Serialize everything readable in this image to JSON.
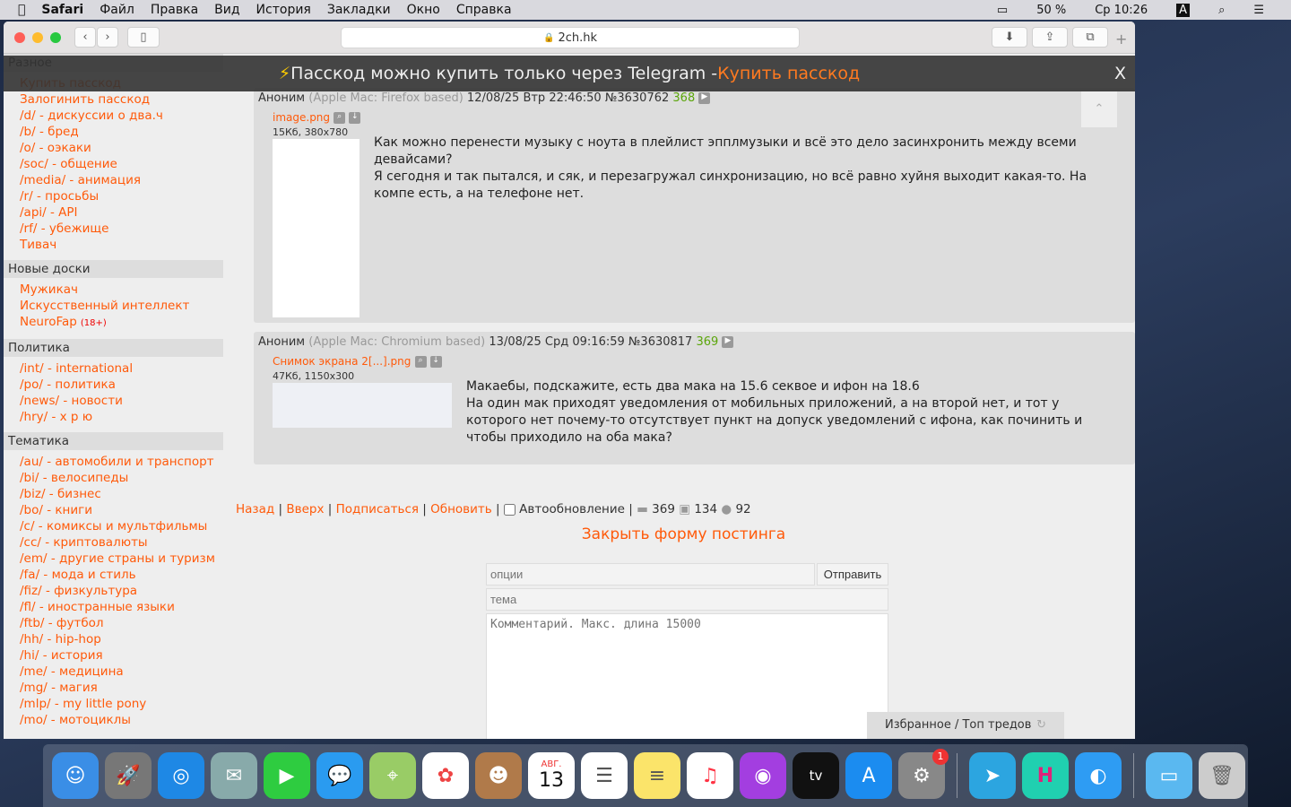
{
  "menubar": {
    "app": "Safari",
    "items": [
      "Файл",
      "Правка",
      "Вид",
      "История",
      "Закладки",
      "Окно",
      "Справка"
    ],
    "battery": "50 %",
    "clock": "Ср 10:26",
    "input": "A"
  },
  "browser": {
    "url": "2ch.hk"
  },
  "banner": {
    "text": "Пасскод можно купить только через Telegram - ",
    "link": "Купить пасскод",
    "close": "X"
  },
  "sidebar": {
    "groups": [
      {
        "title": "Разное",
        "items": [
          "Купить пасскод",
          "Залогинить пасскод",
          "/d/ - дискуссии о два.ч",
          "/b/ - бред",
          "/o/ - оэкаки",
          "/soc/ - общение",
          "/media/ - анимация",
          "/r/ - просьбы",
          "/api/ - API",
          "/rf/ - убежище",
          "Тивач"
        ]
      },
      {
        "title": "Новые доски",
        "items": [
          "Мужикач",
          "Искусственный интеллект",
          "NeuroFap"
        ],
        "badge": "(18+)"
      },
      {
        "title": "Политика",
        "items": [
          "/int/ - international",
          "/po/ - политика",
          "/news/ - новости",
          "/hry/ - х р ю"
        ]
      },
      {
        "title": "Тематика",
        "items": [
          "/au/ - автомобили и транспорт",
          "/bi/ - велосипеды",
          "/biz/ - бизнес",
          "/bo/ - книги",
          "/c/ - комиксы и мультфильмы",
          "/cc/ - криптовалюты",
          "/em/ - другие страны и туризм",
          "/fa/ - мода и стиль",
          "/fiz/ - физкультура",
          "/fl/ - иностранные языки",
          "/ftb/ - футбол",
          "/hh/ - hip-hop",
          "/hi/ - история",
          "/me/ - медицина",
          "/mg/ - магия",
          "/mlp/ - my little pony",
          "/mo/ - мотоциклы"
        ]
      }
    ]
  },
  "posts": [
    {
      "name": "Аноним",
      "ua": "(Apple Mac: Firefox based)",
      "date": "12/08/25 Втр 22:46:50",
      "num": "№3630762",
      "idx": "368",
      "file": "image.png",
      "meta": "15Кб, 380x780",
      "text": "Как можно перенести музыку с ноута в плейлист эпплмузыки и всё это дело засинхронить между всеми девайсами?\nЯ сегодня и так пытался, и сяк, и перезагружал синхронизацию, но всё равно хуйня выходит какая-то. На компе есть, а на телефоне нет."
    },
    {
      "name": "Аноним",
      "ua": "(Apple Mac: Chromium based)",
      "date": "13/08/25 Срд 09:16:59",
      "num": "№3630817",
      "idx": "369",
      "file": "Снимок экрана 2[...].png",
      "meta": "47Кб, 1150x300",
      "text": "Макаебы, подскажите, есть два мака на 15.6 секвое и ифон на 18.6\nНа один мак приходят уведомления от мобильных приложений, а на второй нет, и тот у которого нет почему-то отсутствует пункт на допуск уведомлений с ифона, как починить и чтобы приходило на оба мака?"
    }
  ],
  "footer": {
    "back": "Назад",
    "top": "Вверх",
    "subscribe": "Подписаться",
    "refresh": "Обновить",
    "autoupdate": "Автообновление",
    "posts": "369",
    "images": "134",
    "users": "92"
  },
  "form": {
    "close": "Закрыть форму постинга",
    "options_placeholder": "опции",
    "submit": "Отправить",
    "subject_placeholder": "тема",
    "comment_placeholder": "Комментарий. Макс. длина 15000"
  },
  "favorites": "Избранное / Топ тредов",
  "dock": {
    "calendar_month": "АВГ.",
    "calendar_day": "13",
    "badge": "1"
  }
}
